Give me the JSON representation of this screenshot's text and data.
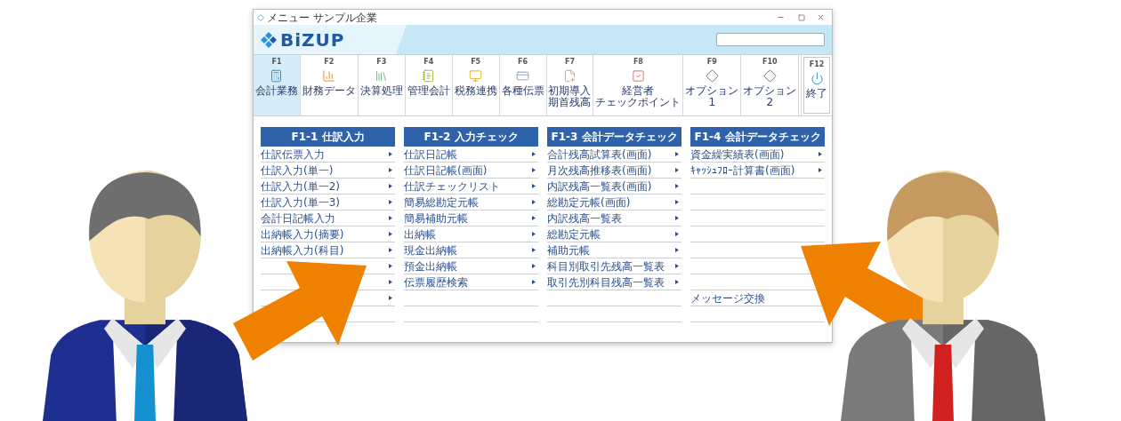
{
  "window": {
    "title": "メニュー サンプル企業"
  },
  "logo": {
    "text": "BiZUP"
  },
  "tabs": [
    {
      "key": "F1",
      "label_lines": [
        "会計業務"
      ],
      "kind": "calculator",
      "selected": true
    },
    {
      "key": "F2",
      "label_lines": [
        "財務データ"
      ],
      "kind": "bars",
      "selected": false
    },
    {
      "key": "F3",
      "label_lines": [
        "決算処理"
      ],
      "kind": "books",
      "selected": false
    },
    {
      "key": "F4",
      "label_lines": [
        "管理会計"
      ],
      "kind": "notebook",
      "selected": false
    },
    {
      "key": "F5",
      "label_lines": [
        "税務連携"
      ],
      "kind": "monitor",
      "selected": false
    },
    {
      "key": "F6",
      "label_lines": [
        "各種伝票"
      ],
      "kind": "slip",
      "selected": false
    },
    {
      "key": "F7",
      "label_lines": [
        "初期導入",
        "期首残高"
      ],
      "kind": "docplus",
      "selected": false
    },
    {
      "key": "F8",
      "label_lines": [
        "経営者",
        "チェックポイント"
      ],
      "kind": "check",
      "selected": false
    },
    {
      "key": "F9",
      "label_lines": [
        "オプション",
        "1"
      ],
      "kind": "diamond",
      "selected": false
    },
    {
      "key": "F10",
      "label_lines": [
        "オプション",
        "2"
      ],
      "kind": "diamond",
      "selected": false
    },
    {
      "kind": "empty"
    },
    {
      "key": "F12",
      "label_lines": [
        "終了"
      ],
      "kind": "power",
      "selected": false
    }
  ],
  "panels": [
    {
      "title": "F1-1 仕訳入力",
      "rows": [
        {
          "label": "仕訳伝票入力",
          "arrow": true
        },
        {
          "label": "仕訳入力(単一)",
          "arrow": true
        },
        {
          "label": "仕訳入力(単一2)",
          "arrow": true
        },
        {
          "label": "仕訳入力(単一3)",
          "arrow": true
        },
        {
          "label": "会計日記帳入力",
          "arrow": true
        },
        {
          "label": "出納帳入力(摘要)",
          "arrow": true
        },
        {
          "label": "出納帳入力(科目)",
          "arrow": true
        },
        {
          "arrow": true
        },
        {
          "arrow": true
        },
        {
          "arrow": true
        },
        {
          "arrow": false
        }
      ]
    },
    {
      "title": "F1-2 入力チェック",
      "rows": [
        {
          "label": "仕訳日記帳",
          "arrow": true
        },
        {
          "label": "仕訳日記帳(画面)",
          "arrow": true
        },
        {
          "label": "仕訳チェックリスト",
          "arrow": true
        },
        {
          "label": "簡易総勘定元帳",
          "arrow": true
        },
        {
          "label": "簡易補助元帳",
          "arrow": true
        },
        {
          "label": "出納帳",
          "arrow": true
        },
        {
          "label": "現金出納帳",
          "arrow": true
        },
        {
          "label": "預金出納帳",
          "arrow": true
        },
        {
          "label": "伝票履歴検索",
          "arrow": true
        },
        {
          "arrow": false
        },
        {
          "arrow": false
        }
      ]
    },
    {
      "title": "F1-3 会計データチェック",
      "rows": [
        {
          "label": "合計残高試算表(画面)",
          "arrow": true
        },
        {
          "label": "月次残高推移表(画面)",
          "arrow": true
        },
        {
          "label": "内訳残高一覧表(画面)",
          "arrow": true
        },
        {
          "label": "総勘定元帳(画面)",
          "arrow": true
        },
        {
          "label": "内訳残高一覧表",
          "arrow": true
        },
        {
          "label": "総勘定元帳",
          "arrow": true
        },
        {
          "label": "補助元帳",
          "arrow": true
        },
        {
          "label": "科目別取引先残高一覧表",
          "arrow": true
        },
        {
          "label": "取引先別科目残高一覧表",
          "arrow": true
        },
        {
          "arrow": false
        },
        {
          "arrow": false
        }
      ]
    },
    {
      "title": "F1-4 会計データチェック",
      "rows": [
        {
          "label": "資金繰実績表(画面)",
          "arrow": true
        },
        {
          "label": "ｷｬｯｼｭﾌﾛｰ計算書(画面)",
          "arrow": true
        },
        {
          "arrow": false
        },
        {
          "arrow": false
        },
        {
          "arrow": false
        },
        {
          "arrow": false
        },
        {
          "arrow": false
        },
        {
          "arrow": false
        },
        {
          "arrow": false
        },
        {
          "label": "メッセージ交換",
          "arrow": false
        },
        {
          "arrow": false
        }
      ]
    }
  ]
}
